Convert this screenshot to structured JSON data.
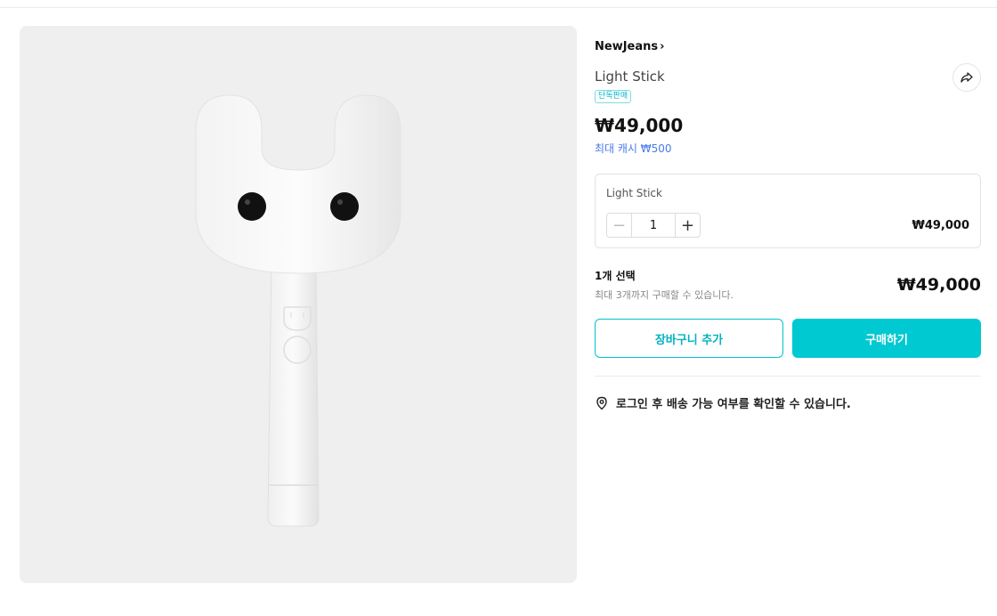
{
  "product": {
    "brand": "NewJeans",
    "brand_chevron": "›",
    "name": "Light Stick",
    "badge": "단독판매",
    "price": "₩49,000",
    "cash": "최대 캐시 ₩500",
    "image_alt": "NewJeans light stick"
  },
  "option": {
    "name": "Light Stick",
    "minus": "−",
    "quantity": "1",
    "plus": "+",
    "price": "₩49,000"
  },
  "summary": {
    "selected": "1개 선택",
    "limit": "최대 3개까지 구매할 수 있습니다.",
    "total": "₩49,000"
  },
  "actions": {
    "cart": "장바구니 추가",
    "buy": "구매하기"
  },
  "delivery": {
    "text": "로그인 후 배송 가능 여부를 확인할 수 있습니다."
  },
  "icons": {
    "share": "share-icon",
    "location": "location-pin-icon"
  },
  "colors": {
    "accent": "#00c9d2",
    "cash": "#4a7be8"
  }
}
